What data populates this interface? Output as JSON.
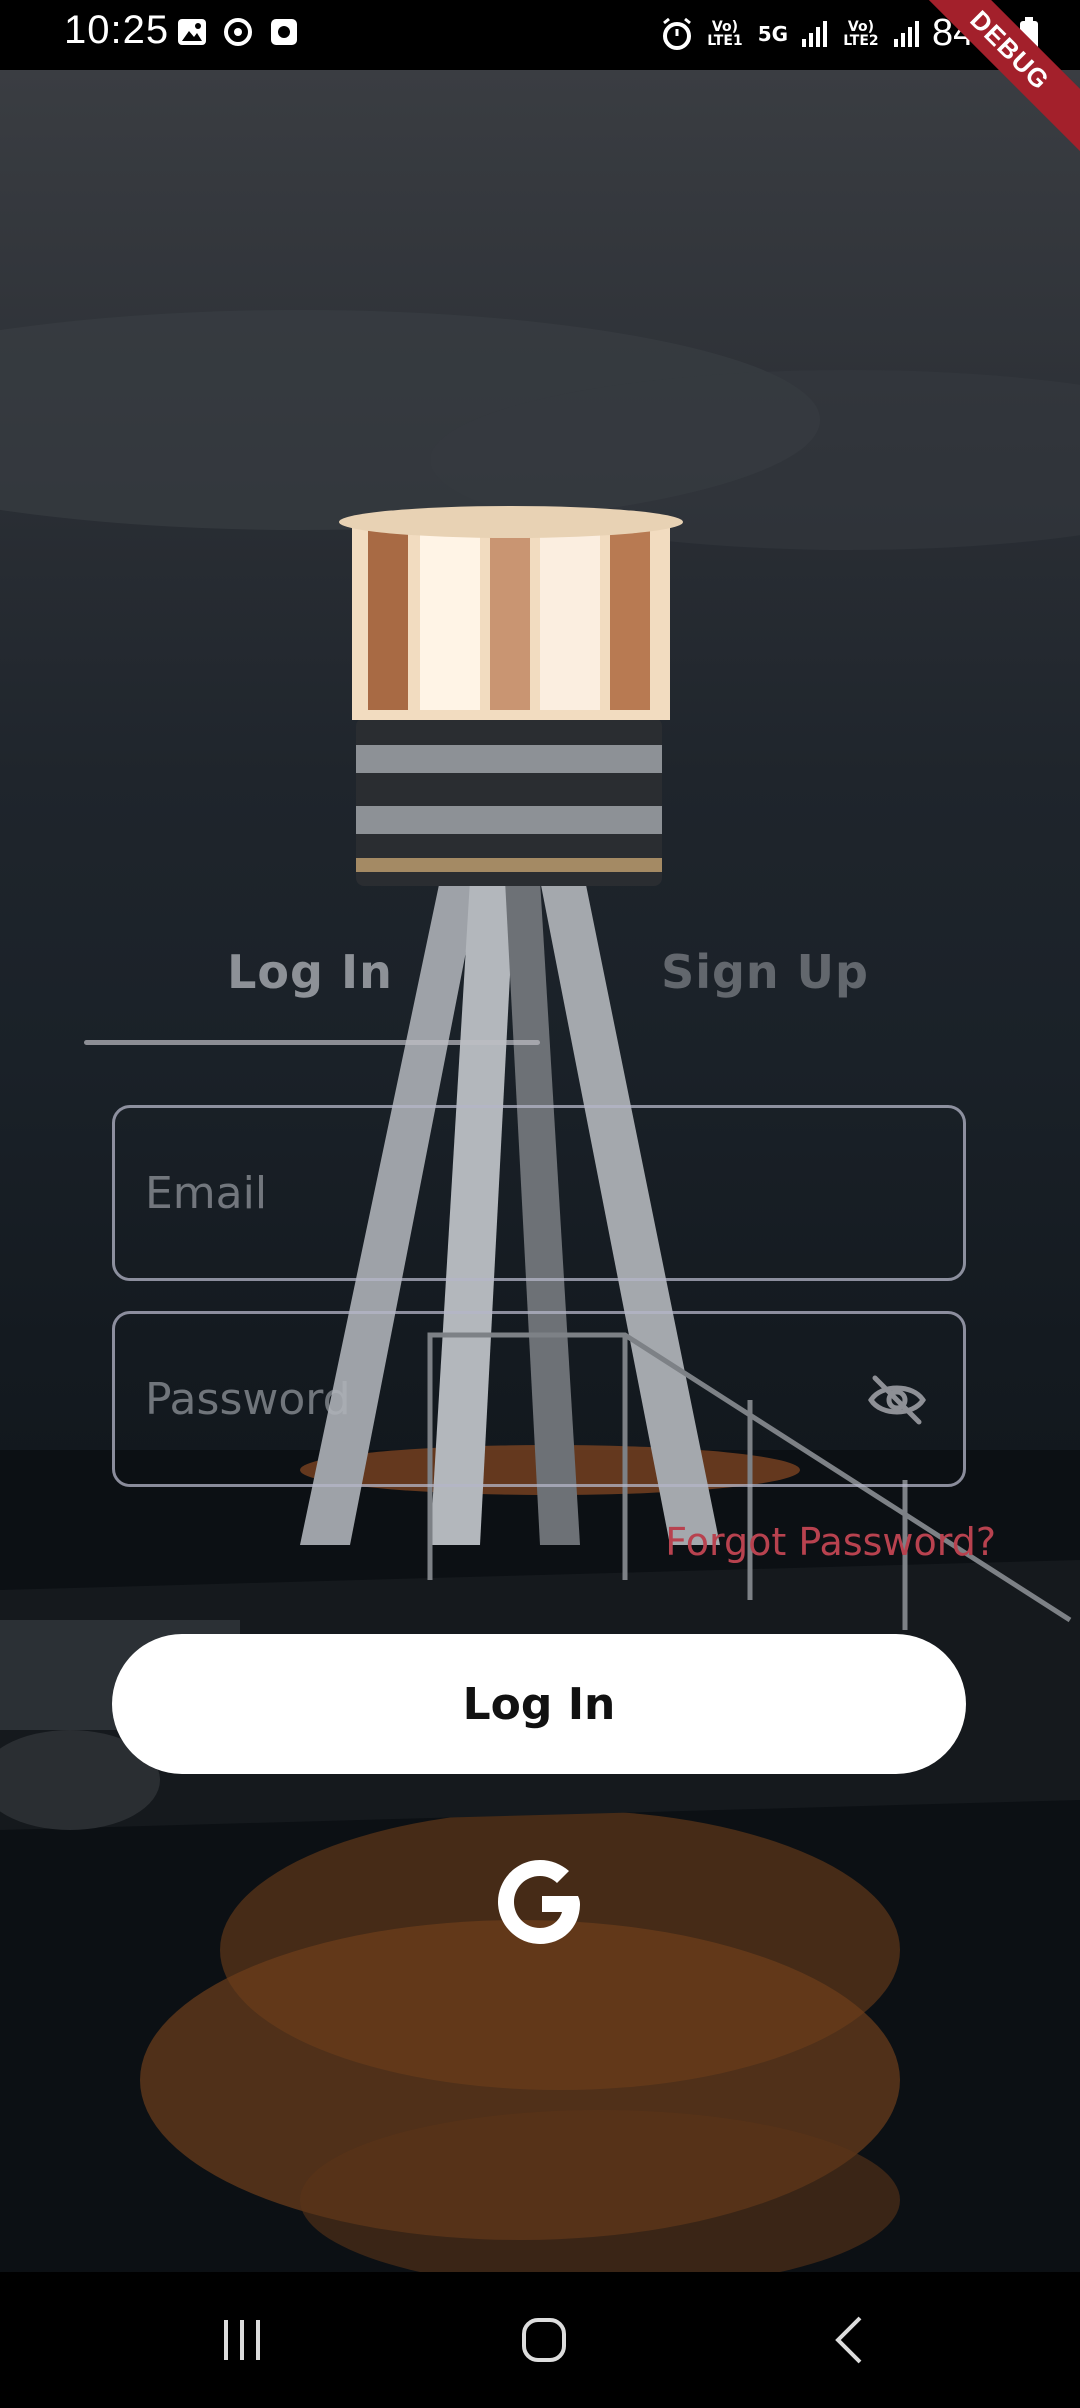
{
  "status_bar": {
    "time": "10:25",
    "battery": "84%",
    "sim1_label": "Vo) LTE1",
    "sim2_label": "Vo) LTE2",
    "network_label": "5G",
    "notification_icons": [
      "image-icon",
      "sync-icon",
      "app-icon"
    ],
    "right_icons": [
      "alarm-icon",
      "signal-icon",
      "battery-icon"
    ]
  },
  "debug_banner": "DEBUG",
  "tabs": [
    {
      "label": "Log In",
      "selected": true
    },
    {
      "label": "Sign Up",
      "selected": false
    }
  ],
  "form": {
    "email_placeholder": "Email",
    "password_placeholder": "Password",
    "forgot_label": "Forgot Password?",
    "login_label": "Log In"
  },
  "colors": {
    "accent_forgot": "#b8424f",
    "button_bg": "#ffffff"
  },
  "nav": {
    "icons": [
      "recents-icon",
      "home-icon",
      "back-icon"
    ]
  }
}
